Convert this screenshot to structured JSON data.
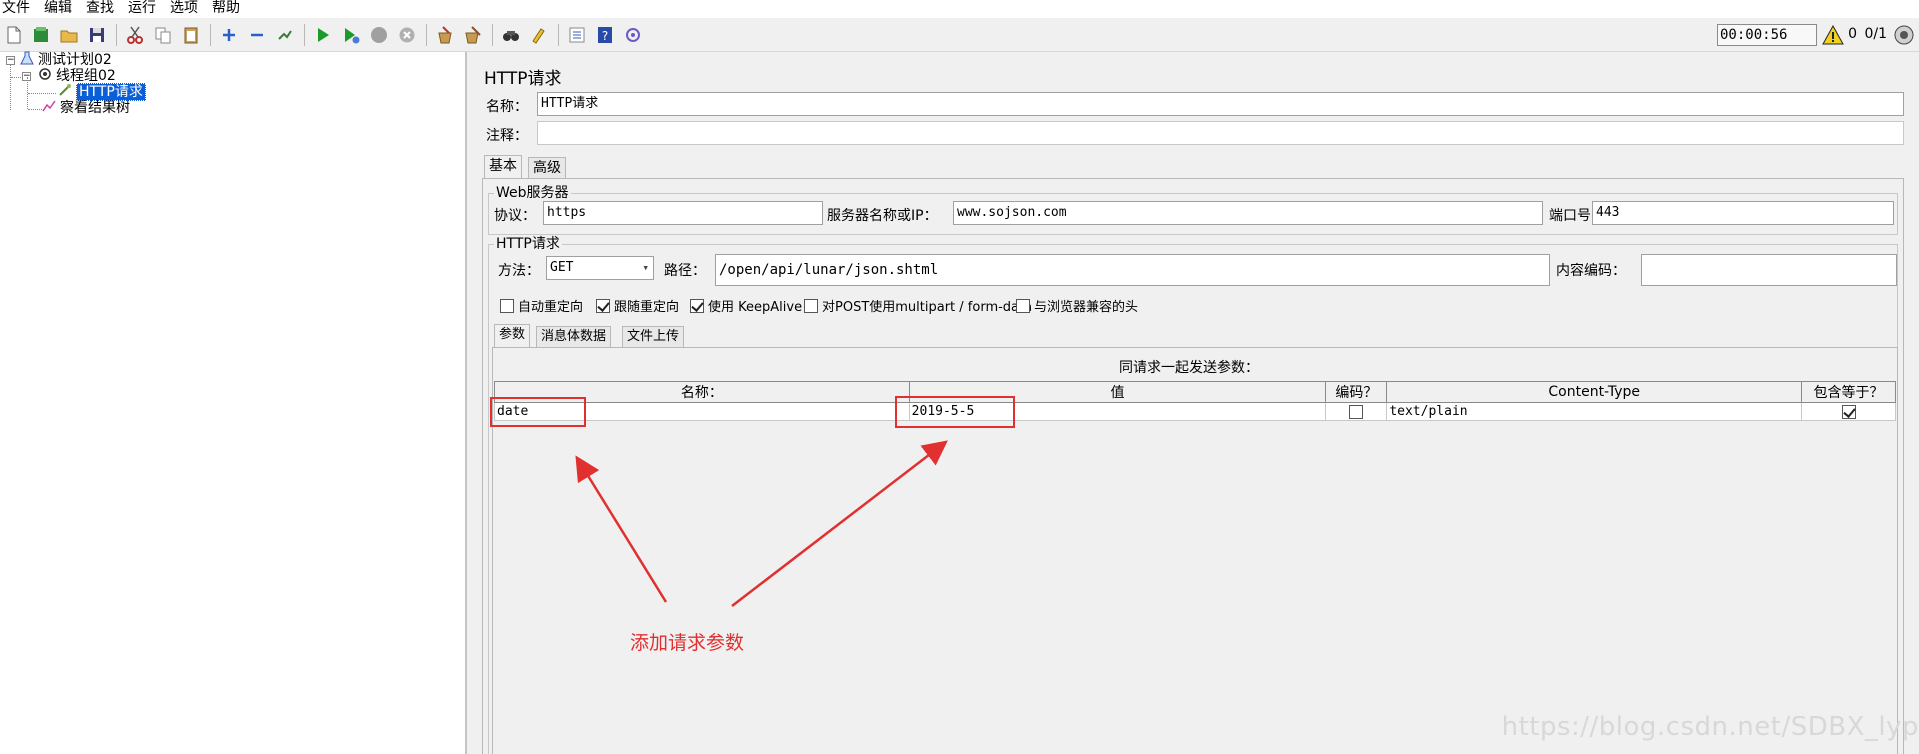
{
  "menu": [
    "文件",
    "编辑",
    "查找",
    "运行",
    "选项",
    "帮助"
  ],
  "toolbar": {
    "icons": [
      "new-icon",
      "templates-icon",
      "open-icon",
      "save-icon",
      "cut-icon",
      "copy-icon",
      "paste-icon",
      "expand-icon",
      "collapse-icon",
      "toggle-icon",
      "start-icon",
      "start-no-timers-icon",
      "stop-icon",
      "shutdown-icon",
      "clear-icon",
      "clear-all-icon",
      "search-icon",
      "reset-search-icon",
      "function-helper-icon",
      "help-icon",
      "remote-icon"
    ],
    "timer": "00:00:56",
    "warning_count": "0",
    "threads": "0/1"
  },
  "tree": {
    "items": [
      {
        "label": "测试计划02",
        "icon": "test-plan-icon"
      },
      {
        "label": "线程组02",
        "icon": "thread-group-icon"
      },
      {
        "label": "HTTP请求",
        "icon": "sampler-icon"
      },
      {
        "label": "察看结果树",
        "icon": "listener-icon"
      }
    ]
  },
  "panel": {
    "title": "HTTP请求",
    "name_label": "名称：",
    "name_value": "HTTP请求",
    "comment_label": "注释："
  },
  "tabs": [
    "基本",
    "高级"
  ],
  "web_server": {
    "title": "Web服务器",
    "protocol_label": "协议：",
    "protocol_value": "https",
    "server_label": "服务器名称或IP：",
    "server_value": "www.sojson.com",
    "port_label": "端口号：",
    "port_value": "443"
  },
  "http_request": {
    "title": "HTTP请求",
    "method_label": "方法：",
    "method_value": "GET",
    "path_label": "路径：",
    "path_value": "/open/api/lunar/json.shtml",
    "encoding_label": "内容编码："
  },
  "options": [
    {
      "label": "自动重定向",
      "checked": false
    },
    {
      "label": "跟随重定向",
      "checked": true
    },
    {
      "label": "使用 KeepAlive",
      "checked": true
    },
    {
      "label": "对POST使用multipart / form-data",
      "checked": false
    },
    {
      "label": "与浏览器兼容的头",
      "checked": false
    }
  ],
  "sub_tabs": [
    "参数",
    "消息体数据",
    "文件上传"
  ],
  "params": {
    "title": "同请求一起发送参数：",
    "headers": [
      "名称：",
      "值",
      "编码？",
      "Content-Type",
      "包含等于？"
    ],
    "rows": [
      {
        "name": "date",
        "value": "2019-5-5",
        "encode": false,
        "content_type": "text/plain",
        "include_equals": true
      }
    ]
  },
  "annotation": "添加请求参数",
  "watermark": "https://blog.csdn.net/SDBX_lyp"
}
